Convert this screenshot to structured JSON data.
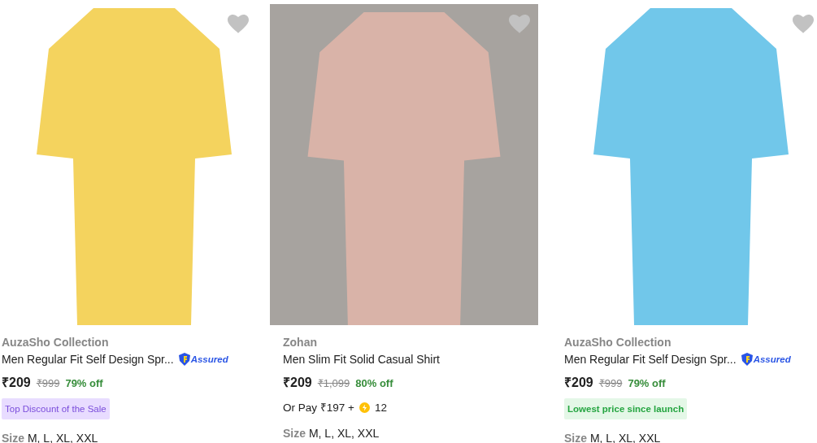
{
  "products": [
    {
      "brand": "AuzaSho Collection",
      "title": "Men Regular Fit Self Design Spr...",
      "assured": true,
      "assured_label": "Assured",
      "price": "₹209",
      "mrp": "₹999",
      "discount": "79% off",
      "badge": {
        "kind": "deal",
        "text": "Top Discount of the Sale"
      },
      "size_label": "Size",
      "sizes": "M, L, XL, XXL"
    },
    {
      "brand": "Zohan",
      "title": "Men Slim Fit Solid Casual Shirt",
      "assured": false,
      "price": "₹209",
      "mrp": "₹1,099",
      "discount": "80% off",
      "pay": {
        "text": "Or Pay ₹197 +",
        "coins": "12"
      },
      "size_label": "Size",
      "sizes": "M, L, XL, XXL"
    },
    {
      "brand": "AuzaSho Collection",
      "title": "Men Regular Fit Self Design Spr...",
      "assured": true,
      "assured_label": "Assured",
      "price": "₹209",
      "mrp": "₹999",
      "discount": "79% off",
      "badge": {
        "kind": "lowest",
        "text": "Lowest price since launch"
      },
      "size_label": "Size",
      "sizes": "M, L, XL, XXL"
    }
  ]
}
